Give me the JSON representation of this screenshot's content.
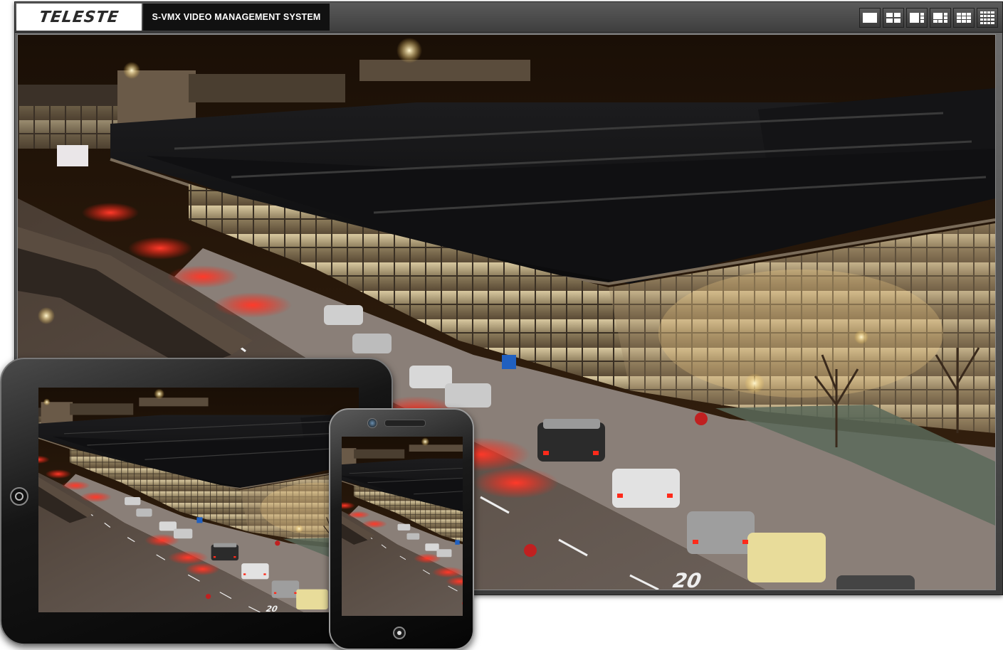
{
  "header": {
    "logo_text": "TELESTE",
    "system_title": "S-VMX VIDEO MANAGEMENT SYSTEM"
  },
  "layout_buttons": [
    {
      "name": "layout-1x1-icon"
    },
    {
      "name": "layout-2x2-icon"
    },
    {
      "name": "layout-1plus3-icon"
    },
    {
      "name": "layout-1plus5-icon"
    },
    {
      "name": "layout-3x3-icon"
    },
    {
      "name": "layout-4x4-icon"
    }
  ],
  "video": {
    "scene": "night-airport-terminal",
    "signs": [
      "20"
    ]
  },
  "colors": {
    "toolbar_bg": "#4a4a4a",
    "title_bg": "#111111",
    "logo_bg": "#ffffff"
  }
}
